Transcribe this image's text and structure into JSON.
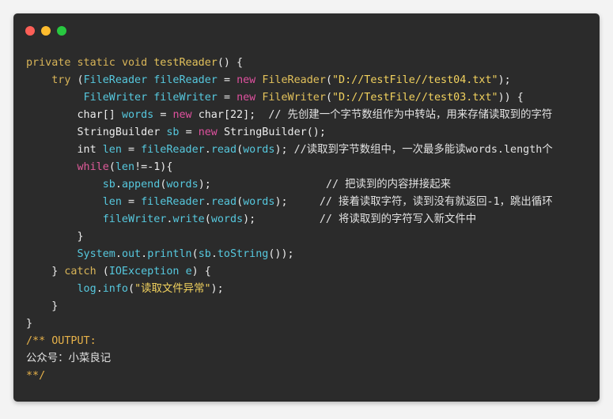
{
  "window": {
    "controls": [
      {
        "name": "close",
        "color": "#fd5f57"
      },
      {
        "name": "minimize",
        "color": "#febc2e"
      },
      {
        "name": "maximize",
        "color": "#28c840"
      }
    ]
  },
  "code": {
    "lines": [
      [
        {
          "text": "private ",
          "cls": "tok-ctrl"
        },
        {
          "text": "static ",
          "cls": "tok-ctrl"
        },
        {
          "text": "void ",
          "cls": "tok-ctrl"
        },
        {
          "text": "testReader",
          "cls": "tok-fn"
        },
        {
          "text": "() {",
          "cls": "tok-tx"
        }
      ],
      [
        {
          "text": "    ",
          "cls": "tok-tx"
        },
        {
          "text": "try ",
          "cls": "tok-ctrl"
        },
        {
          "text": "(",
          "cls": "tok-tx"
        },
        {
          "text": "FileReader ",
          "cls": "tok-type"
        },
        {
          "text": "fileReader ",
          "cls": "tok-var"
        },
        {
          "text": "= ",
          "cls": "tok-tx"
        },
        {
          "text": "new ",
          "cls": "tok-op"
        },
        {
          "text": "FileReader",
          "cls": "tok-fn"
        },
        {
          "text": "(",
          "cls": "tok-tx"
        },
        {
          "text": "\"D://TestFile//test04.txt\"",
          "cls": "tok-str"
        },
        {
          "text": ");",
          "cls": "tok-tx"
        }
      ],
      [
        {
          "text": "         ",
          "cls": "tok-tx"
        },
        {
          "text": "FileWriter ",
          "cls": "tok-type"
        },
        {
          "text": "fileWriter ",
          "cls": "tok-var"
        },
        {
          "text": "= ",
          "cls": "tok-tx"
        },
        {
          "text": "new ",
          "cls": "tok-op"
        },
        {
          "text": "FileWriter",
          "cls": "tok-fn"
        },
        {
          "text": "(",
          "cls": "tok-tx"
        },
        {
          "text": "\"D://TestFile//test03.txt\"",
          "cls": "tok-str"
        },
        {
          "text": ")) {",
          "cls": "tok-tx"
        }
      ],
      [
        {
          "text": "        ",
          "cls": "tok-tx"
        },
        {
          "text": "char",
          "cls": "tok-tx"
        },
        {
          "text": "[] ",
          "cls": "tok-tx"
        },
        {
          "text": "words ",
          "cls": "tok-var"
        },
        {
          "text": "= ",
          "cls": "tok-tx"
        },
        {
          "text": "new ",
          "cls": "tok-op"
        },
        {
          "text": "char",
          "cls": "tok-tx"
        },
        {
          "text": "[22];  ",
          "cls": "tok-tx"
        },
        {
          "text": "// 先创建一个字节数组作为中转站，用来存储读取到的字符",
          "cls": "tok-cm"
        }
      ],
      [
        {
          "text": "        ",
          "cls": "tok-tx"
        },
        {
          "text": "StringBuilder ",
          "cls": "tok-tx"
        },
        {
          "text": "sb ",
          "cls": "tok-var"
        },
        {
          "text": "= ",
          "cls": "tok-tx"
        },
        {
          "text": "new ",
          "cls": "tok-op"
        },
        {
          "text": "StringBuilder",
          "cls": "tok-tx"
        },
        {
          "text": "();",
          "cls": "tok-tx"
        }
      ],
      [
        {
          "text": "        ",
          "cls": "tok-tx"
        },
        {
          "text": "int ",
          "cls": "tok-tx"
        },
        {
          "text": "len ",
          "cls": "tok-var"
        },
        {
          "text": "= ",
          "cls": "tok-tx"
        },
        {
          "text": "fileReader",
          "cls": "tok-var"
        },
        {
          "text": ".",
          "cls": "tok-tx"
        },
        {
          "text": "read",
          "cls": "tok-var"
        },
        {
          "text": "(",
          "cls": "tok-tx"
        },
        {
          "text": "words",
          "cls": "tok-var"
        },
        {
          "text": "); ",
          "cls": "tok-tx"
        },
        {
          "text": "//读取到字节数组中，一次最多能读words.length个",
          "cls": "tok-cm"
        }
      ],
      [
        {
          "text": "        ",
          "cls": "tok-tx"
        },
        {
          "text": "while",
          "cls": "tok-kwp"
        },
        {
          "text": "(",
          "cls": "tok-tx"
        },
        {
          "text": "len",
          "cls": "tok-var"
        },
        {
          "text": "!=-1){",
          "cls": "tok-tx"
        }
      ],
      [
        {
          "text": "            ",
          "cls": "tok-tx"
        },
        {
          "text": "sb",
          "cls": "tok-var"
        },
        {
          "text": ".",
          "cls": "tok-tx"
        },
        {
          "text": "append",
          "cls": "tok-var"
        },
        {
          "text": "(",
          "cls": "tok-tx"
        },
        {
          "text": "words",
          "cls": "tok-var"
        },
        {
          "text": ");                  ",
          "cls": "tok-tx"
        },
        {
          "text": "// 把读到的内容拼接起来",
          "cls": "tok-cm"
        }
      ],
      [
        {
          "text": "            ",
          "cls": "tok-tx"
        },
        {
          "text": "len ",
          "cls": "tok-var"
        },
        {
          "text": "= ",
          "cls": "tok-tx"
        },
        {
          "text": "fileReader",
          "cls": "tok-var"
        },
        {
          "text": ".",
          "cls": "tok-tx"
        },
        {
          "text": "read",
          "cls": "tok-var"
        },
        {
          "text": "(",
          "cls": "tok-tx"
        },
        {
          "text": "words",
          "cls": "tok-var"
        },
        {
          "text": ");     ",
          "cls": "tok-tx"
        },
        {
          "text": "// 接着读取字符，读到没有就返回-1，跳出循环",
          "cls": "tok-cm"
        }
      ],
      [
        {
          "text": "            ",
          "cls": "tok-tx"
        },
        {
          "text": "fileWriter",
          "cls": "tok-var"
        },
        {
          "text": ".",
          "cls": "tok-tx"
        },
        {
          "text": "write",
          "cls": "tok-var"
        },
        {
          "text": "(",
          "cls": "tok-tx"
        },
        {
          "text": "words",
          "cls": "tok-var"
        },
        {
          "text": ");          ",
          "cls": "tok-tx"
        },
        {
          "text": "// 将读取到的字符写入新文件中",
          "cls": "tok-cm"
        }
      ],
      [
        {
          "text": "        }",
          "cls": "tok-tx"
        }
      ],
      [
        {
          "text": "        ",
          "cls": "tok-tx"
        },
        {
          "text": "System",
          "cls": "tok-var"
        },
        {
          "text": ".",
          "cls": "tok-tx"
        },
        {
          "text": "out",
          "cls": "tok-var"
        },
        {
          "text": ".",
          "cls": "tok-tx"
        },
        {
          "text": "println",
          "cls": "tok-var"
        },
        {
          "text": "(",
          "cls": "tok-tx"
        },
        {
          "text": "sb",
          "cls": "tok-var"
        },
        {
          "text": ".",
          "cls": "tok-tx"
        },
        {
          "text": "toString",
          "cls": "tok-var"
        },
        {
          "text": "());",
          "cls": "tok-tx"
        }
      ],
      [
        {
          "text": "    } ",
          "cls": "tok-tx"
        },
        {
          "text": "catch ",
          "cls": "tok-ctrl"
        },
        {
          "text": "(",
          "cls": "tok-tx"
        },
        {
          "text": "IOException ",
          "cls": "tok-type"
        },
        {
          "text": "e",
          "cls": "tok-var"
        },
        {
          "text": ") {",
          "cls": "tok-tx"
        }
      ],
      [
        {
          "text": "        ",
          "cls": "tok-tx"
        },
        {
          "text": "log",
          "cls": "tok-var"
        },
        {
          "text": ".",
          "cls": "tok-tx"
        },
        {
          "text": "info",
          "cls": "tok-var"
        },
        {
          "text": "(",
          "cls": "tok-tx"
        },
        {
          "text": "\"读取文件异常\"",
          "cls": "tok-str"
        },
        {
          "text": ");",
          "cls": "tok-tx"
        }
      ],
      [
        {
          "text": "    }",
          "cls": "tok-tx"
        }
      ],
      [
        {
          "text": "}",
          "cls": "tok-tx"
        }
      ],
      [
        {
          "text": "/** OUTPUT:",
          "cls": "tok-kw"
        }
      ],
      [
        {
          "text": "公众号：小菜良记",
          "cls": "tok-cm"
        }
      ],
      [
        {
          "text": "**/",
          "cls": "tok-kw"
        }
      ]
    ]
  }
}
